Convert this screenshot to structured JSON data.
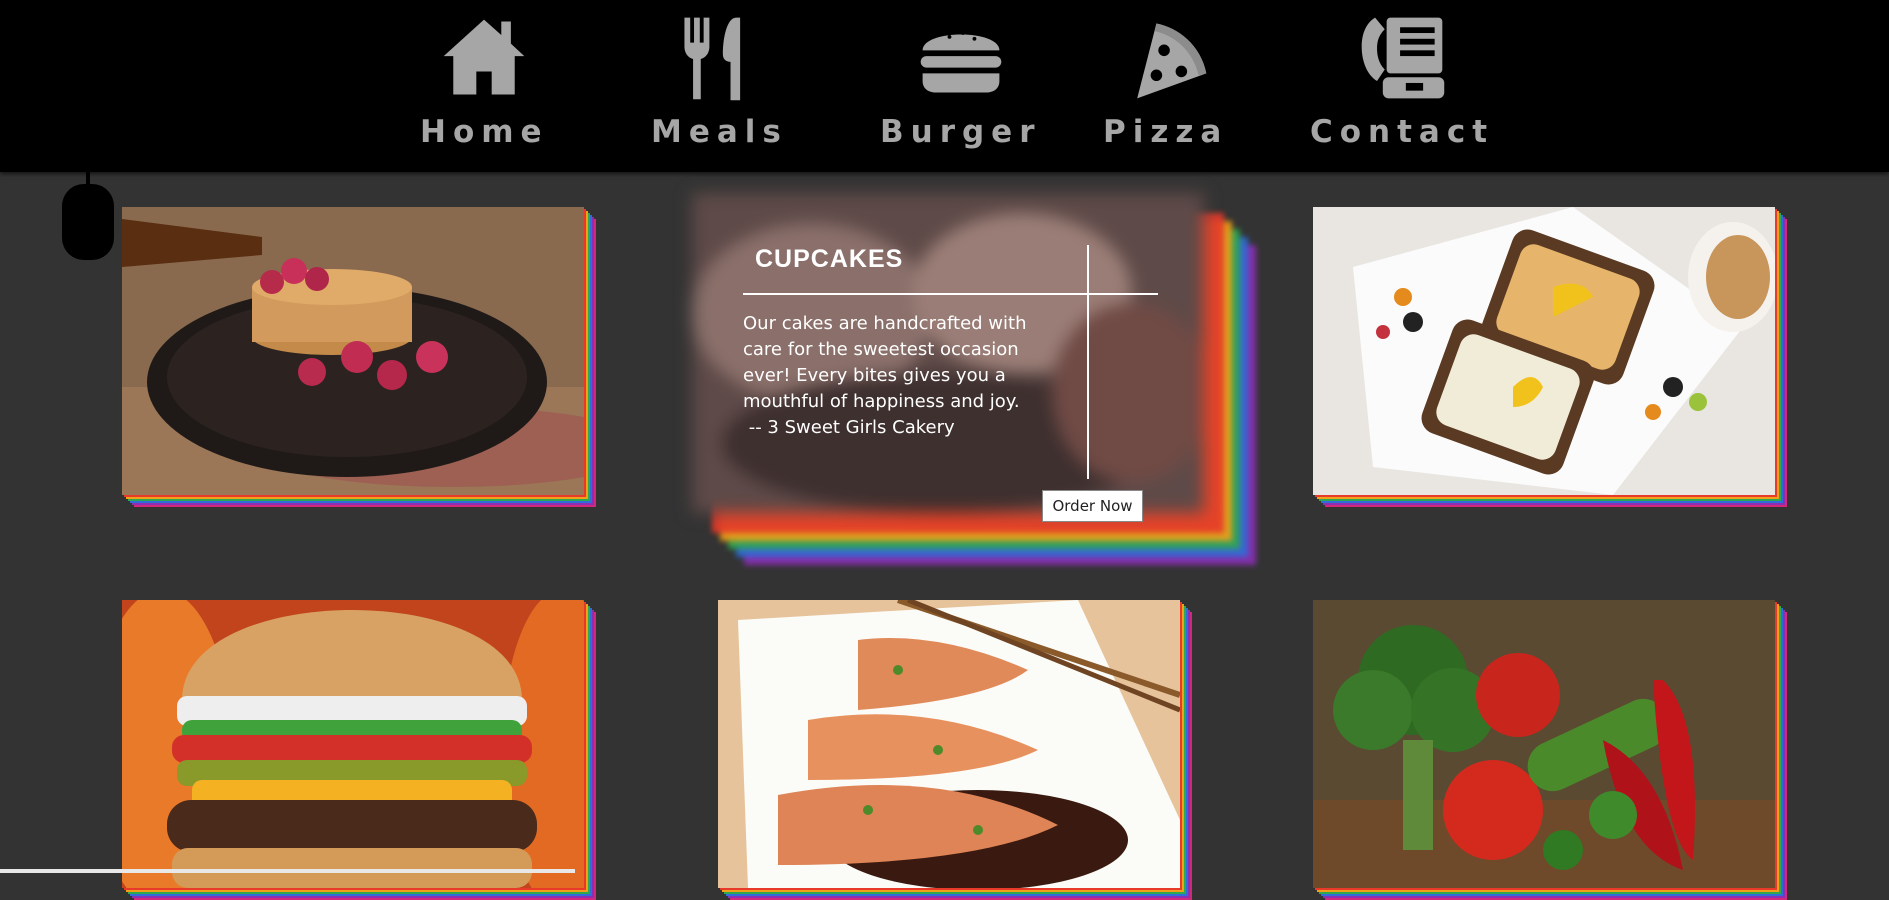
{
  "nav": {
    "items": [
      {
        "label": "Home",
        "icon": "home-icon"
      },
      {
        "label": "Meals",
        "icon": "fork-knife-icon"
      },
      {
        "label": "Burger",
        "icon": "burger-icon"
      },
      {
        "label": "Pizza",
        "icon": "pizza-icon"
      },
      {
        "label": "Contact",
        "icon": "phone-icon"
      }
    ]
  },
  "feature": {
    "title": "CUPCAKES",
    "text": "Our cakes are handcrafted with care for the sweetest occasion ever! Every bites gives you a mouthful of happiness and joy.",
    "attribution": " -- 3 Sweet Girls Cakery",
    "button_label": "Order Now"
  },
  "gallery": [
    {
      "name": "pancakes-image"
    },
    {
      "name": "toast-platter-image"
    },
    {
      "name": "burger-image"
    },
    {
      "name": "salmon-image"
    },
    {
      "name": "vegetables-image"
    }
  ],
  "colors": {
    "background": "#333333",
    "nav_background": "#000000",
    "nav_text": "#a6a6a6",
    "shadow_stack": [
      "#e83a2a",
      "#f1a017",
      "#2fa84f",
      "#2f6ed8",
      "#8c2fb5",
      "#d0287a"
    ]
  }
}
